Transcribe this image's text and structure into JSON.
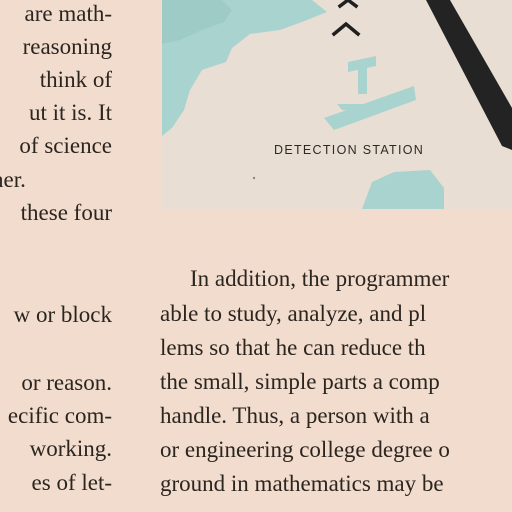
{
  "page": {
    "background": "#f1dccd",
    "text_color": "#2b2520"
  },
  "illustration": {
    "caption": "DETECTION STATION",
    "colors": {
      "panel": "#e9ded3",
      "teal": "#a9d3cf",
      "dark": "#232323"
    }
  },
  "left_column": {
    "lines": [
      "are math-",
      "reasoning",
      "think of",
      "ut it is. It",
      "of science",
      "her.",
      "these four",
      "",
      "w or block",
      "",
      "or reason.",
      "ecific com-",
      "working.",
      "es of let-",
      "~"
    ]
  },
  "right_column": {
    "lines": [
      "In addition, the programmer",
      "able to study, analyze, and pl",
      "lems so that he can reduce th",
      "the small, simple parts a comp",
      "handle. Thus, a person with a",
      "or engineering college degree o",
      "ground in mathematics may be",
      "~"
    ]
  }
}
